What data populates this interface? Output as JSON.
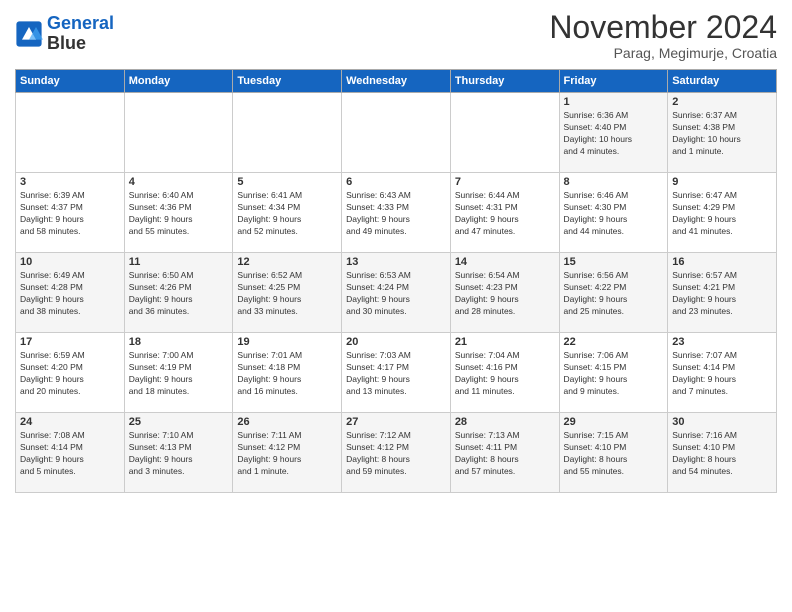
{
  "logo": {
    "line1": "General",
    "line2": "Blue"
  },
  "title": "November 2024",
  "subtitle": "Parag, Megimurje, Croatia",
  "days_of_week": [
    "Sunday",
    "Monday",
    "Tuesday",
    "Wednesday",
    "Thursday",
    "Friday",
    "Saturday"
  ],
  "weeks": [
    [
      {
        "day": "",
        "info": ""
      },
      {
        "day": "",
        "info": ""
      },
      {
        "day": "",
        "info": ""
      },
      {
        "day": "",
        "info": ""
      },
      {
        "day": "",
        "info": ""
      },
      {
        "day": "1",
        "info": "Sunrise: 6:36 AM\nSunset: 4:40 PM\nDaylight: 10 hours\nand 4 minutes."
      },
      {
        "day": "2",
        "info": "Sunrise: 6:37 AM\nSunset: 4:38 PM\nDaylight: 10 hours\nand 1 minute."
      }
    ],
    [
      {
        "day": "3",
        "info": "Sunrise: 6:39 AM\nSunset: 4:37 PM\nDaylight: 9 hours\nand 58 minutes."
      },
      {
        "day": "4",
        "info": "Sunrise: 6:40 AM\nSunset: 4:36 PM\nDaylight: 9 hours\nand 55 minutes."
      },
      {
        "day": "5",
        "info": "Sunrise: 6:41 AM\nSunset: 4:34 PM\nDaylight: 9 hours\nand 52 minutes."
      },
      {
        "day": "6",
        "info": "Sunrise: 6:43 AM\nSunset: 4:33 PM\nDaylight: 9 hours\nand 49 minutes."
      },
      {
        "day": "7",
        "info": "Sunrise: 6:44 AM\nSunset: 4:31 PM\nDaylight: 9 hours\nand 47 minutes."
      },
      {
        "day": "8",
        "info": "Sunrise: 6:46 AM\nSunset: 4:30 PM\nDaylight: 9 hours\nand 44 minutes."
      },
      {
        "day": "9",
        "info": "Sunrise: 6:47 AM\nSunset: 4:29 PM\nDaylight: 9 hours\nand 41 minutes."
      }
    ],
    [
      {
        "day": "10",
        "info": "Sunrise: 6:49 AM\nSunset: 4:28 PM\nDaylight: 9 hours\nand 38 minutes."
      },
      {
        "day": "11",
        "info": "Sunrise: 6:50 AM\nSunset: 4:26 PM\nDaylight: 9 hours\nand 36 minutes."
      },
      {
        "day": "12",
        "info": "Sunrise: 6:52 AM\nSunset: 4:25 PM\nDaylight: 9 hours\nand 33 minutes."
      },
      {
        "day": "13",
        "info": "Sunrise: 6:53 AM\nSunset: 4:24 PM\nDaylight: 9 hours\nand 30 minutes."
      },
      {
        "day": "14",
        "info": "Sunrise: 6:54 AM\nSunset: 4:23 PM\nDaylight: 9 hours\nand 28 minutes."
      },
      {
        "day": "15",
        "info": "Sunrise: 6:56 AM\nSunset: 4:22 PM\nDaylight: 9 hours\nand 25 minutes."
      },
      {
        "day": "16",
        "info": "Sunrise: 6:57 AM\nSunset: 4:21 PM\nDaylight: 9 hours\nand 23 minutes."
      }
    ],
    [
      {
        "day": "17",
        "info": "Sunrise: 6:59 AM\nSunset: 4:20 PM\nDaylight: 9 hours\nand 20 minutes."
      },
      {
        "day": "18",
        "info": "Sunrise: 7:00 AM\nSunset: 4:19 PM\nDaylight: 9 hours\nand 18 minutes."
      },
      {
        "day": "19",
        "info": "Sunrise: 7:01 AM\nSunset: 4:18 PM\nDaylight: 9 hours\nand 16 minutes."
      },
      {
        "day": "20",
        "info": "Sunrise: 7:03 AM\nSunset: 4:17 PM\nDaylight: 9 hours\nand 13 minutes."
      },
      {
        "day": "21",
        "info": "Sunrise: 7:04 AM\nSunset: 4:16 PM\nDaylight: 9 hours\nand 11 minutes."
      },
      {
        "day": "22",
        "info": "Sunrise: 7:06 AM\nSunset: 4:15 PM\nDaylight: 9 hours\nand 9 minutes."
      },
      {
        "day": "23",
        "info": "Sunrise: 7:07 AM\nSunset: 4:14 PM\nDaylight: 9 hours\nand 7 minutes."
      }
    ],
    [
      {
        "day": "24",
        "info": "Sunrise: 7:08 AM\nSunset: 4:14 PM\nDaylight: 9 hours\nand 5 minutes."
      },
      {
        "day": "25",
        "info": "Sunrise: 7:10 AM\nSunset: 4:13 PM\nDaylight: 9 hours\nand 3 minutes."
      },
      {
        "day": "26",
        "info": "Sunrise: 7:11 AM\nSunset: 4:12 PM\nDaylight: 9 hours\nand 1 minute."
      },
      {
        "day": "27",
        "info": "Sunrise: 7:12 AM\nSunset: 4:12 PM\nDaylight: 8 hours\nand 59 minutes."
      },
      {
        "day": "28",
        "info": "Sunrise: 7:13 AM\nSunset: 4:11 PM\nDaylight: 8 hours\nand 57 minutes."
      },
      {
        "day": "29",
        "info": "Sunrise: 7:15 AM\nSunset: 4:10 PM\nDaylight: 8 hours\nand 55 minutes."
      },
      {
        "day": "30",
        "info": "Sunrise: 7:16 AM\nSunset: 4:10 PM\nDaylight: 8 hours\nand 54 minutes."
      }
    ]
  ]
}
